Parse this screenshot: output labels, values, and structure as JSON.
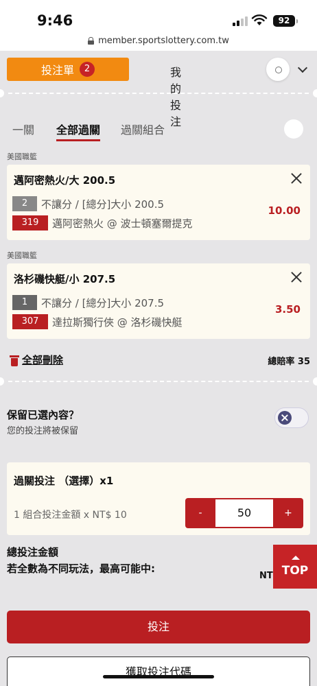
{
  "status_bar": {
    "time": "9:46",
    "battery": "92"
  },
  "browser": {
    "url": "member.sportslottery.com.tw"
  },
  "top_tabs": {
    "betslip_label": "投注單",
    "betslip_count": "2",
    "mybets_label": "我的投注"
  },
  "sub_tabs": [
    "一關",
    "全部過關",
    "過關組合"
  ],
  "active_sub_tab": "全部過關",
  "bets": [
    {
      "league": "美國職籃",
      "title": "邁阿密熱火/大 200.5",
      "num": "2",
      "market": "不讓分 / [總分]大小 200.5",
      "team_code": "319",
      "match": "邁阿密熱火 @ 波士頓塞爾提克",
      "odds": "10.00"
    },
    {
      "league": "美國職籃",
      "title": "洛杉磯快艇/小 207.5",
      "num": "1",
      "market": "不讓分 / [總分]大小 207.5",
      "team_code": "307",
      "match": "達拉斯獨行俠 @ 洛杉磯快艇",
      "odds": "3.50"
    }
  ],
  "actions": {
    "delete_all": "全部刪除",
    "total_odds": "總賠率 35"
  },
  "keep": {
    "title": "保留已選內容？",
    "subtitle": "您的投注將被保留"
  },
  "parlay": {
    "title": "過關投注 （選擇）x1",
    "subtitle": "1 組合投注金額 x NT$ 10",
    "minus": "-",
    "amount": "50",
    "plus": "+"
  },
  "totals": {
    "total_label": "總投注金額",
    "max_label": "若全數為不同玩法，最高可能中:",
    "nt_prefix": "NT"
  },
  "top_button": "TOP",
  "buttons": {
    "bet": "投注",
    "get_code": "獲取投注代碼"
  },
  "colors": {
    "orange": "#f28a11",
    "red": "#b91f22",
    "card_bg": "#fdfaf0",
    "page_bg": "#e6e5e7"
  }
}
